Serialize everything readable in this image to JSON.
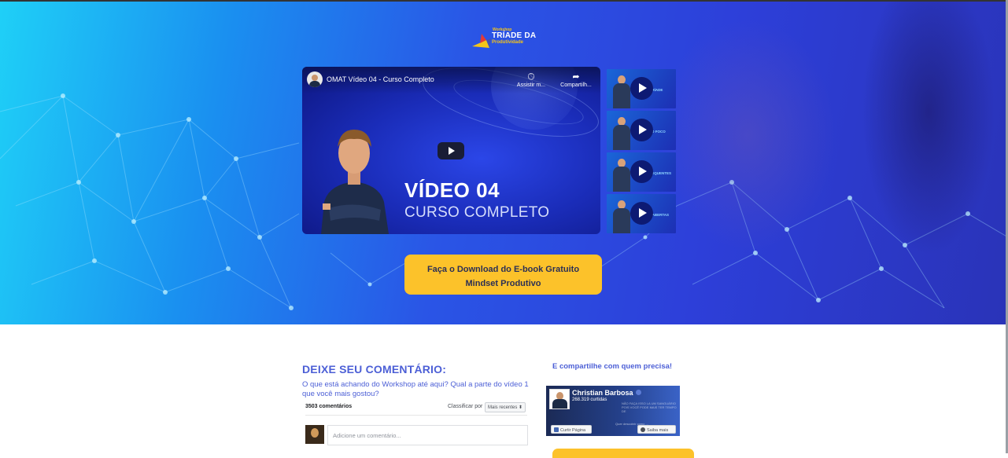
{
  "colors": {
    "accent_blue": "#4c5fd6",
    "cta_yellow": "#fcc22a",
    "cta_text": "#2b2f55",
    "hero_start": "#1fd0f7",
    "hero_end": "#2a33b8"
  },
  "logo": {
    "top_text": "Workshop",
    "main_text": "TRÍADE DA",
    "sub_text": "Produtividade"
  },
  "player": {
    "channel_avatar": "avatar",
    "title": "OMAT Vídeo 04 - Curso Completo",
    "watch_later_icon": "clock-icon",
    "watch_later_label": "Assistir m...",
    "share_icon": "share-arrow-icon",
    "share_label": "Compartilh...",
    "overlay_line1": "VÍDEO 04",
    "overlay_line2": "CURSO COMPLETO",
    "play_icon": "play-icon"
  },
  "playlist": [
    {
      "label": "DA TRÍADE"
    },
    {
      "label": "MERO FOCO"
    },
    {
      "label": "S FREQUENTES"
    },
    {
      "label": "ÕES ABERTAS"
    }
  ],
  "cta": {
    "line1": "Faça o Download do E-book Gratuito",
    "line2": "Mindset Produtivo"
  },
  "comments": {
    "title": "DEIXE SEU COMENTÁRIO:",
    "question": "O que está achando do Workshop até aqui? Qual a parte do vídeo 1 que você mais gostou?",
    "count": "3503 comentários",
    "sort_label": "Classificar por",
    "sort_value": "Mais recentes ⬍",
    "input_placeholder": "Adicione um comentário..."
  },
  "share": {
    "title": "E compartilhe com quem precisa!",
    "page_name": "Christian Barbosa",
    "likes": "268.319 curtidas",
    "bg_text": "NÃO FAÇA ISSO LA UM SANGUÁRIO POIS VOCÊ PODE MAIS TER TEMPO DE",
    "bg_text2": "Quer descobrir como ...",
    "like_button": "Curtir Página",
    "learn_more_button": "Saiba mais"
  }
}
